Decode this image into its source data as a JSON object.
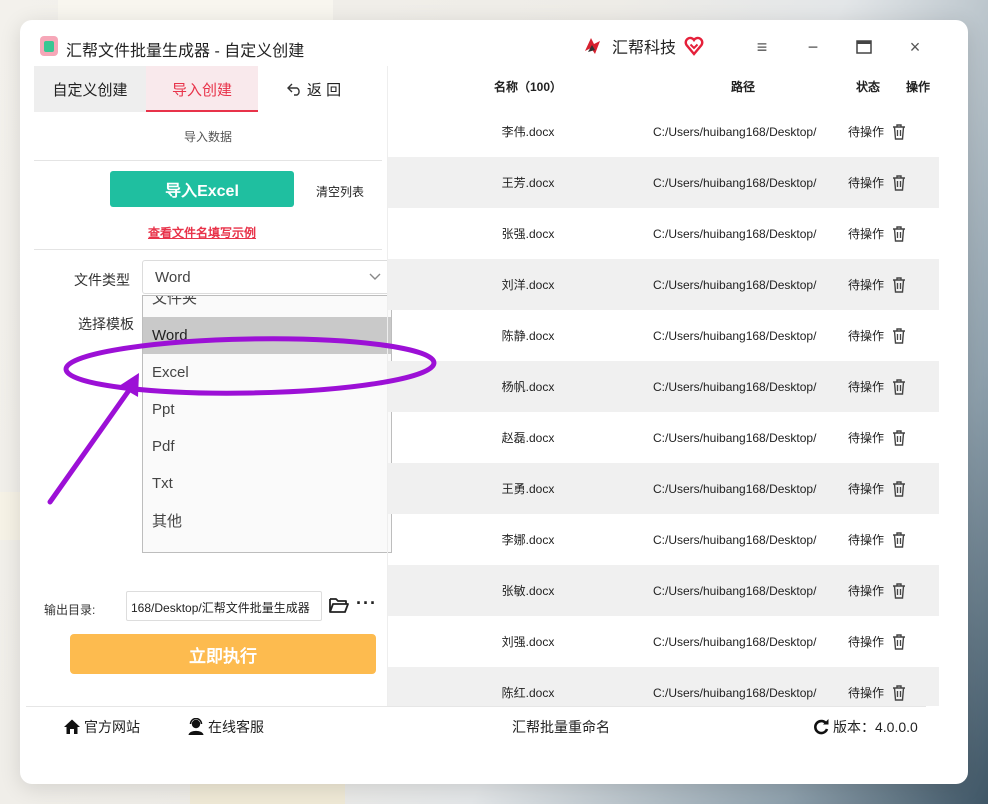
{
  "app": {
    "title": "汇帮文件批量生成器 - 自定义创建",
    "brand": "汇帮科技"
  },
  "window_controls": {
    "menu": "≡",
    "minimize": "−",
    "maximize": "▭",
    "close": "×"
  },
  "left": {
    "tabs": {
      "custom": "自定义创建",
      "import": "导入创建",
      "back": "返 回"
    },
    "import_section_title": "导入数据",
    "import_button": "导入Excel",
    "clear_button": "清空列表",
    "example_link": "查看文件名填写示例",
    "file_type_label": "文件类型",
    "template_label": "选择模板",
    "file_type_value": "Word",
    "dropdown_options": [
      "文件夹",
      "Word",
      "Excel",
      "Ppt",
      "Pdf",
      "Txt",
      "其他"
    ],
    "output_label": "输出目录:",
    "output_value": "168/Desktop/汇帮文件批量生成器",
    "more": "···",
    "run_button": "立即执行"
  },
  "table": {
    "headers": {
      "name": "名称（100）",
      "path": "路径",
      "status": "状态",
      "action": "操作"
    },
    "rows": [
      {
        "name": "李伟.docx",
        "path": "C:/Users/huibang168/Desktop/",
        "status": "待操作"
      },
      {
        "name": "王芳.docx",
        "path": "C:/Users/huibang168/Desktop/",
        "status": "待操作"
      },
      {
        "name": "张强.docx",
        "path": "C:/Users/huibang168/Desktop/",
        "status": "待操作"
      },
      {
        "name": "刘洋.docx",
        "path": "C:/Users/huibang168/Desktop/",
        "status": "待操作"
      },
      {
        "name": "陈静.docx",
        "path": "C:/Users/huibang168/Desktop/",
        "status": "待操作"
      },
      {
        "name": "杨帆.docx",
        "path": "C:/Users/huibang168/Desktop/",
        "status": "待操作"
      },
      {
        "name": "赵磊.docx",
        "path": "C:/Users/huibang168/Desktop/",
        "status": "待操作"
      },
      {
        "name": "王勇.docx",
        "path": "C:/Users/huibang168/Desktop/",
        "status": "待操作"
      },
      {
        "name": "李娜.docx",
        "path": "C:/Users/huibang168/Desktop/",
        "status": "待操作"
      },
      {
        "name": "张敏.docx",
        "path": "C:/Users/huibang168/Desktop/",
        "status": "待操作"
      },
      {
        "name": "刘强.docx",
        "path": "C:/Users/huibang168/Desktop/",
        "status": "待操作"
      },
      {
        "name": "陈红.docx",
        "path": "C:/Users/huibang168/Desktop/",
        "status": "待操作"
      }
    ]
  },
  "statusbar": {
    "website": "官方网站",
    "service": "在线客服",
    "center": "汇帮批量重命名",
    "version": "版本：4.0.0.0"
  },
  "colors": {
    "accent_red": "#e8334a",
    "teal": "#1fbfa0",
    "orange": "#fdbb4f",
    "annotation": "#9c10d6"
  },
  "icons": [
    "app-icon",
    "brand-logo-icon",
    "heart-logo-icon",
    "menu-icon",
    "minimize-icon",
    "maximize-icon",
    "close-icon",
    "back-arrow-icon",
    "chevron-down-icon",
    "folder-icon",
    "more-icon",
    "trash-icon",
    "home-icon",
    "user-icon",
    "refresh-icon"
  ]
}
